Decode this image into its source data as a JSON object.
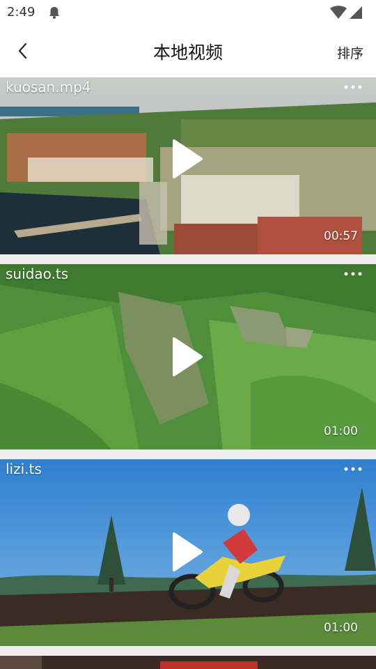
{
  "status_bar": {
    "time": "2:49",
    "icons": [
      "notification-bell-icon",
      "wifi-icon",
      "signal-icon"
    ]
  },
  "header": {
    "back_icon": "chevron-left-icon",
    "title": "本地视频",
    "sort_label": "排序"
  },
  "videos": [
    {
      "name": "kuosan.mp4",
      "duration": "00:57"
    },
    {
      "name": "suidao.ts",
      "duration": "01:00"
    },
    {
      "name": "lizi.ts",
      "duration": "01:00"
    }
  ]
}
